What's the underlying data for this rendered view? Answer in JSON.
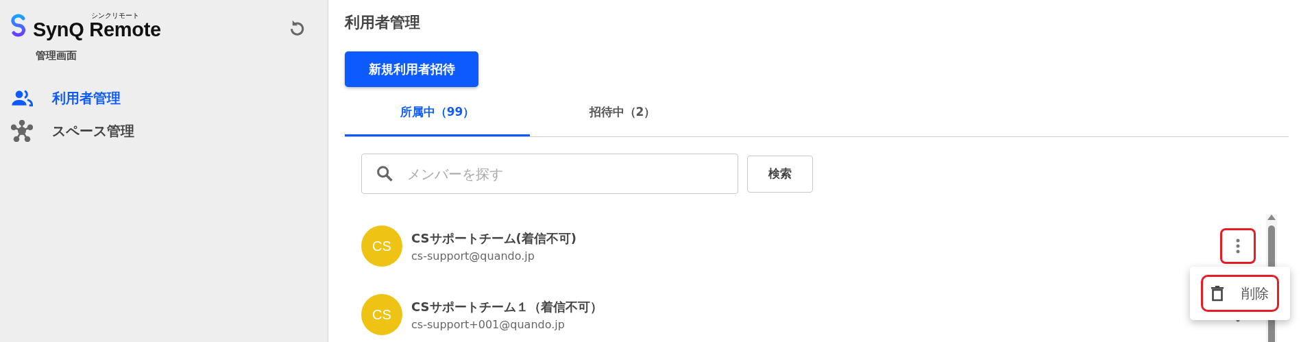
{
  "sidebar": {
    "logo": {
      "name": "SynQ Remote",
      "ruby": "シンクリモート"
    },
    "subtitle": "管理画面",
    "items": [
      {
        "label": "利用者管理",
        "selected": true
      },
      {
        "label": "スペース管理",
        "selected": false
      }
    ]
  },
  "main": {
    "title": "利用者管理",
    "invite_button": "新規利用者招待",
    "tabs": [
      {
        "label": "所属中（99）",
        "selected": true
      },
      {
        "label": "招待中（2）",
        "selected": false
      }
    ],
    "search": {
      "placeholder": "メンバーを探す",
      "button": "検索"
    },
    "members": [
      {
        "initials": "CS",
        "name": "CSサポートチーム(着信不可)",
        "email": "cs-support@quando.jp",
        "highlighted": true
      },
      {
        "initials": "CS",
        "name": "CSサポートチーム１（着信不可）",
        "email": "cs-support+001@quando.jp",
        "highlighted": false
      }
    ],
    "menu": {
      "items": [
        {
          "label": "削除",
          "highlighted": true
        }
      ]
    }
  }
}
